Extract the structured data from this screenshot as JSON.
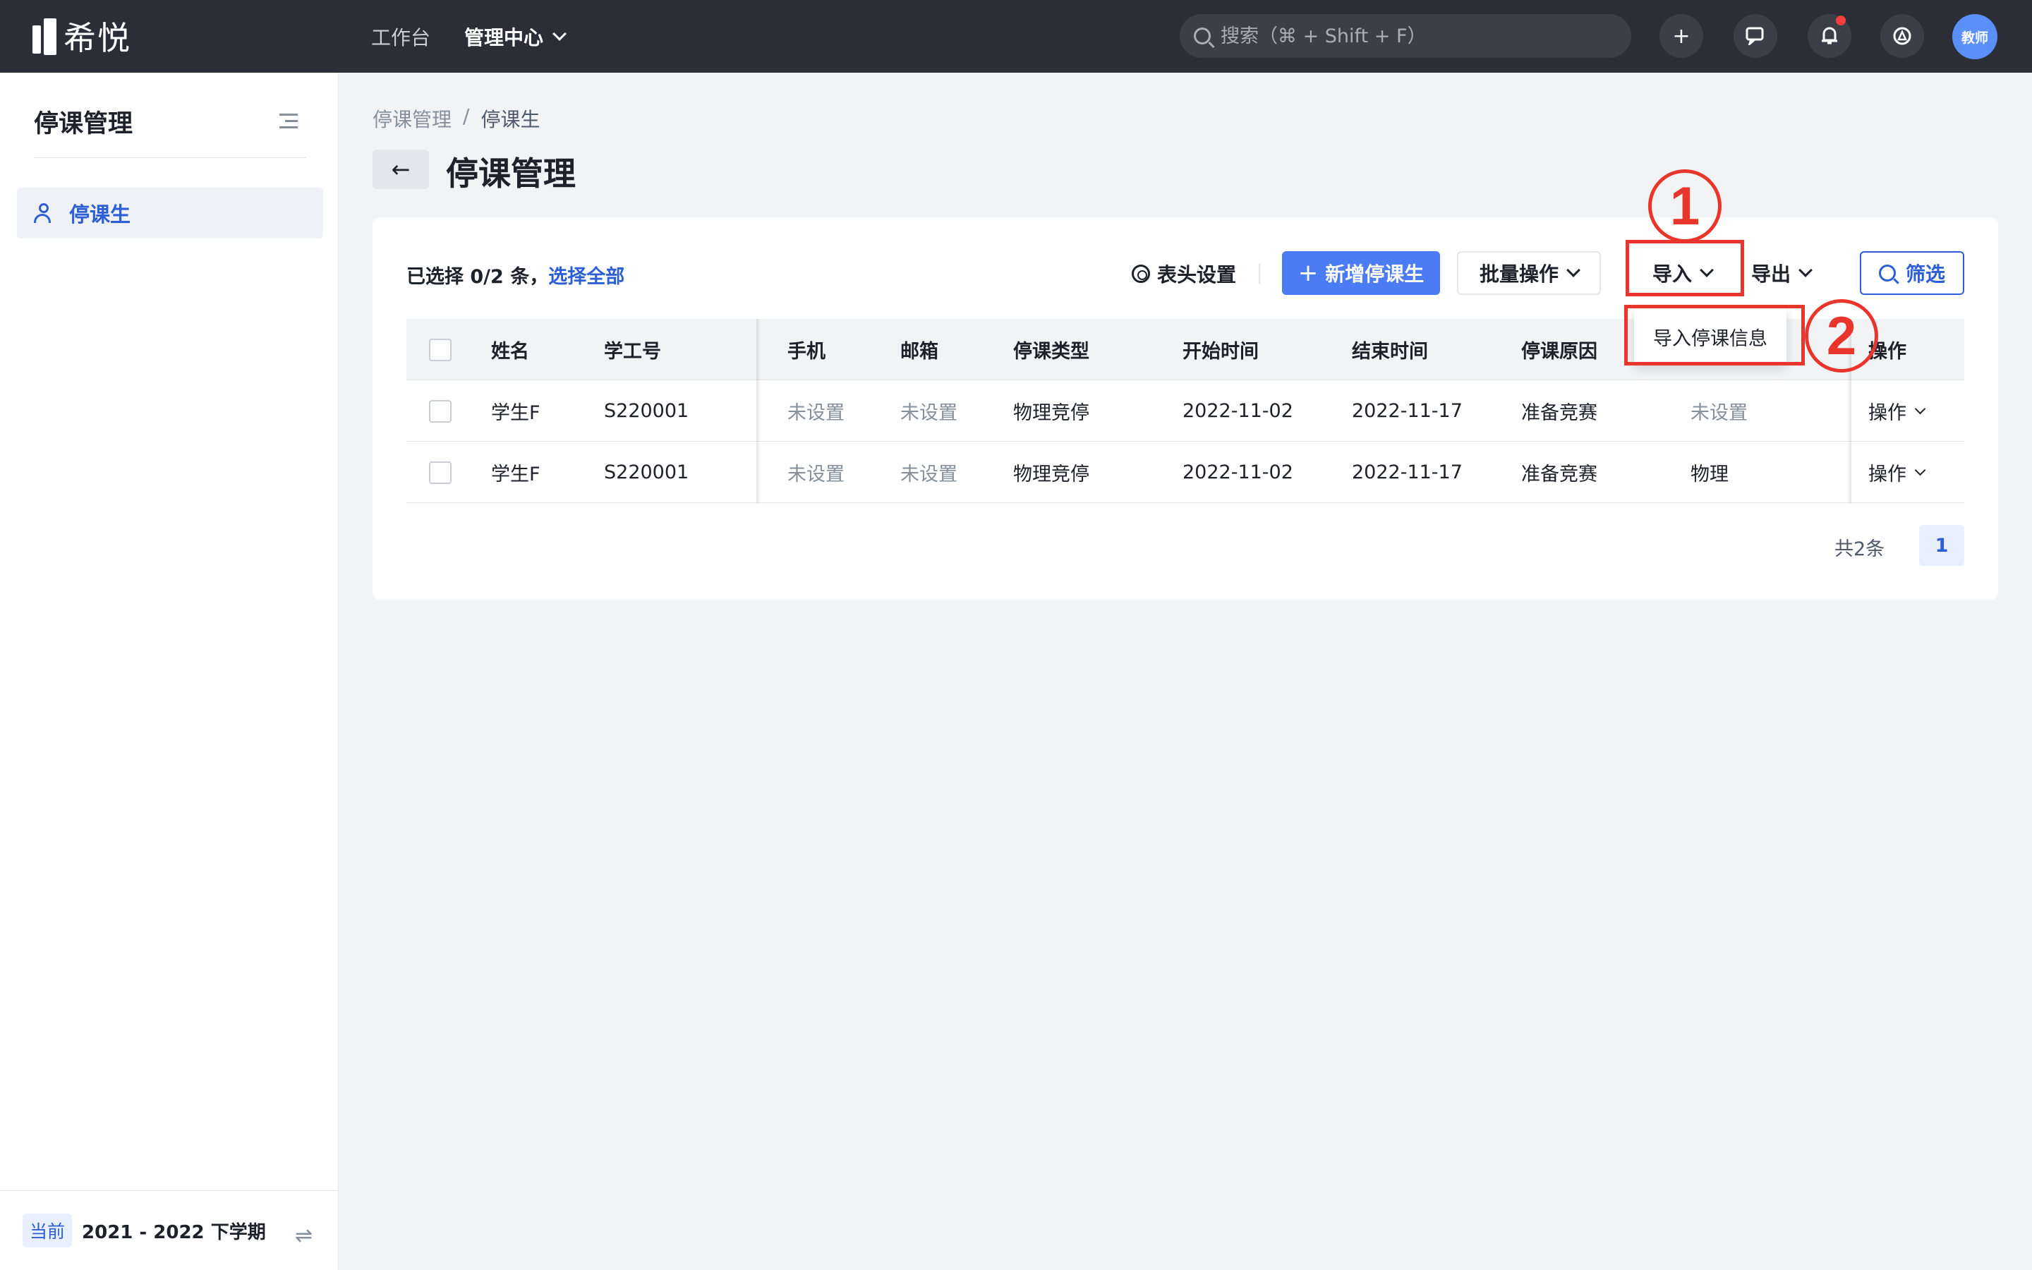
{
  "app": {
    "logo_text": "希悦",
    "nav": [
      "工作台",
      "管理中心"
    ],
    "search_placeholder": "搜索（⌘ + Shift + F）",
    "avatar_label": "教师"
  },
  "sidebar": {
    "title": "停课管理",
    "items": [
      {
        "label": "停课生",
        "active": true
      }
    ],
    "term_badge": "当前",
    "term_text": "2021 - 2022 下学期"
  },
  "breadcrumb": [
    "停课管理",
    "/",
    "停课生"
  ],
  "page": {
    "title": "停课管理"
  },
  "toolbar": {
    "selection_prefix": "已选择 0/2 条，",
    "select_all": "选择全部",
    "header_settings": "表头设置",
    "add_button": "新增停课生",
    "batch_button": "批量操作",
    "import_button": "导入",
    "export_button": "导出",
    "filter_button": "筛选"
  },
  "import_menu": {
    "items": [
      "导入停课信息"
    ]
  },
  "table": {
    "columns": [
      "姓名",
      "学工号",
      "手机",
      "邮箱",
      "停课类型",
      "开始时间",
      "结束时间",
      "停课原因",
      "",
      "操作"
    ],
    "rows": [
      {
        "name": "学生F",
        "id": "S220001",
        "phone": "未设置",
        "email": "未设置",
        "type": "物理竞停",
        "start": "2022-11-02",
        "end": "2022-11-17",
        "reason": "准备竞赛",
        "extra": "未设置",
        "op": "操作"
      },
      {
        "name": "学生F",
        "id": "S220001",
        "phone": "未设置",
        "email": "未设置",
        "type": "物理竞停",
        "start": "2022-11-02",
        "end": "2022-11-17",
        "reason": "准备竞赛",
        "extra": "物理",
        "op": "操作"
      }
    ]
  },
  "pagination": {
    "total": "共2条",
    "current": "1"
  },
  "annotations": {
    "step1": "1",
    "step2": "2",
    "color": "#e8362c"
  },
  "colors": {
    "topbar": "#2b2e36",
    "primary": "#4b7bf5",
    "link": "#2c5fd6"
  }
}
